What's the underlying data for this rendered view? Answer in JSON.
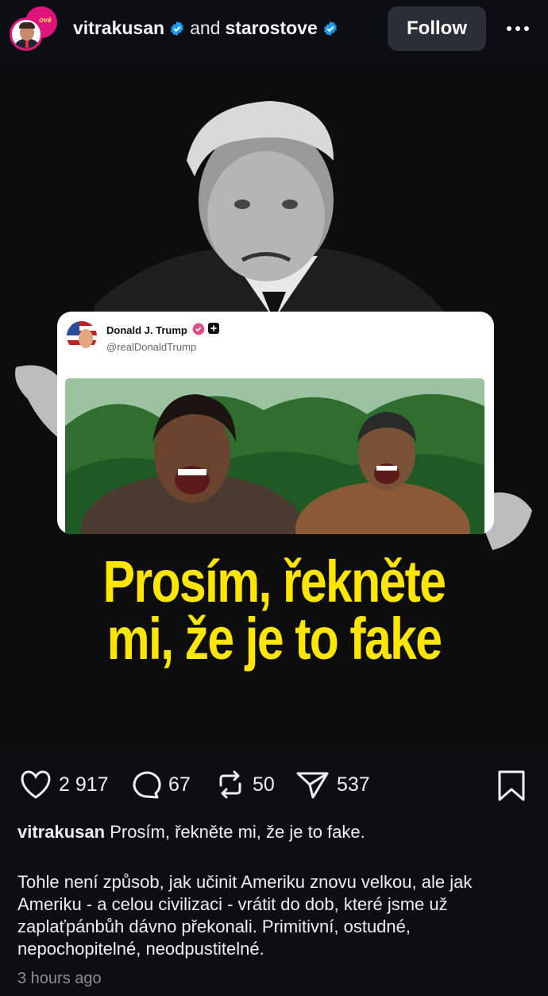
{
  "header": {
    "user1": "vitrakusan",
    "and_text": "and",
    "user2": "starostove",
    "follow_label": "Follow",
    "avatar_badge_text": "ové"
  },
  "post": {
    "tweet": {
      "name": "Donald J. Trump",
      "handle": "@realDonaldTrump"
    },
    "headline_line1": "Prosím, řekněte",
    "headline_line2": "mi, že je to fake"
  },
  "actions": {
    "likes": "2 917",
    "comments": "67",
    "reposts": "50",
    "shares": "537"
  },
  "caption": {
    "user": "vitrakusan",
    "text": "Prosím, řekněte mi, že je to fake."
  },
  "body": "Tohle není způsob, jak učinit Ameriku znovu velkou, ale jak Ameriku - a celou civilizaci - vrátit do dob, které jsme už zaplaťpánbůh dávno překonali. Primitivní, ostudné, nepochopitelné, neodpustitelné.",
  "timestamp": "3 hours ago",
  "colors": {
    "accent_verified": "#1d9bf0",
    "headline_yellow": "#ffe600",
    "avatar_ring": "#e0157a"
  }
}
